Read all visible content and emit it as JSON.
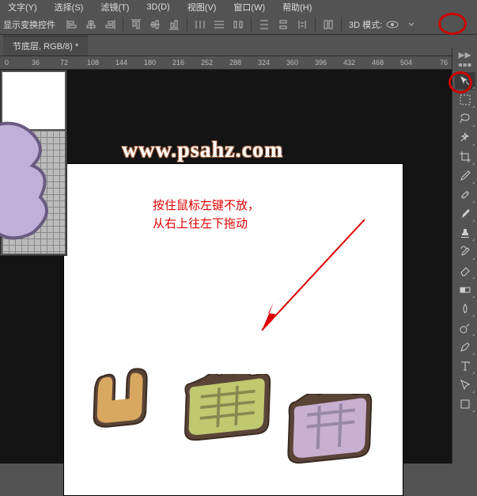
{
  "menu": {
    "text": "文字(Y)",
    "select": "选择(S)",
    "filter": "滤镜(T)",
    "threeD": "3D(D)",
    "view": "视图(V)",
    "window": "窗口(W)",
    "help": "帮助(H)"
  },
  "options": {
    "label": "显示变换控件",
    "mode3d": "3D 模式:"
  },
  "doc": {
    "tab": "节底层, RGB/8) *"
  },
  "ruler": [
    "0",
    "36",
    "72",
    "108",
    "144",
    "180",
    "216",
    "252",
    "288",
    "324",
    "360",
    "396",
    "432",
    "468",
    "504",
    "76"
  ],
  "watermark": "www.psahz.com",
  "annotation": {
    "line1": "按住鼠标左键不放，",
    "line2": "从右上往左下拖动"
  },
  "tools": {
    "move": "move",
    "marquee": "marquee",
    "lasso": "lasso",
    "wand": "wand",
    "crop": "crop",
    "eyedrop": "eyedrop",
    "heal": "heal",
    "brush": "brush",
    "stamp": "stamp",
    "history": "history",
    "eraser": "eraser",
    "gradient": "gradient",
    "blur": "blur",
    "dodge": "dodge",
    "pen": "pen",
    "type": "type",
    "path": "path",
    "rect": "rect"
  }
}
